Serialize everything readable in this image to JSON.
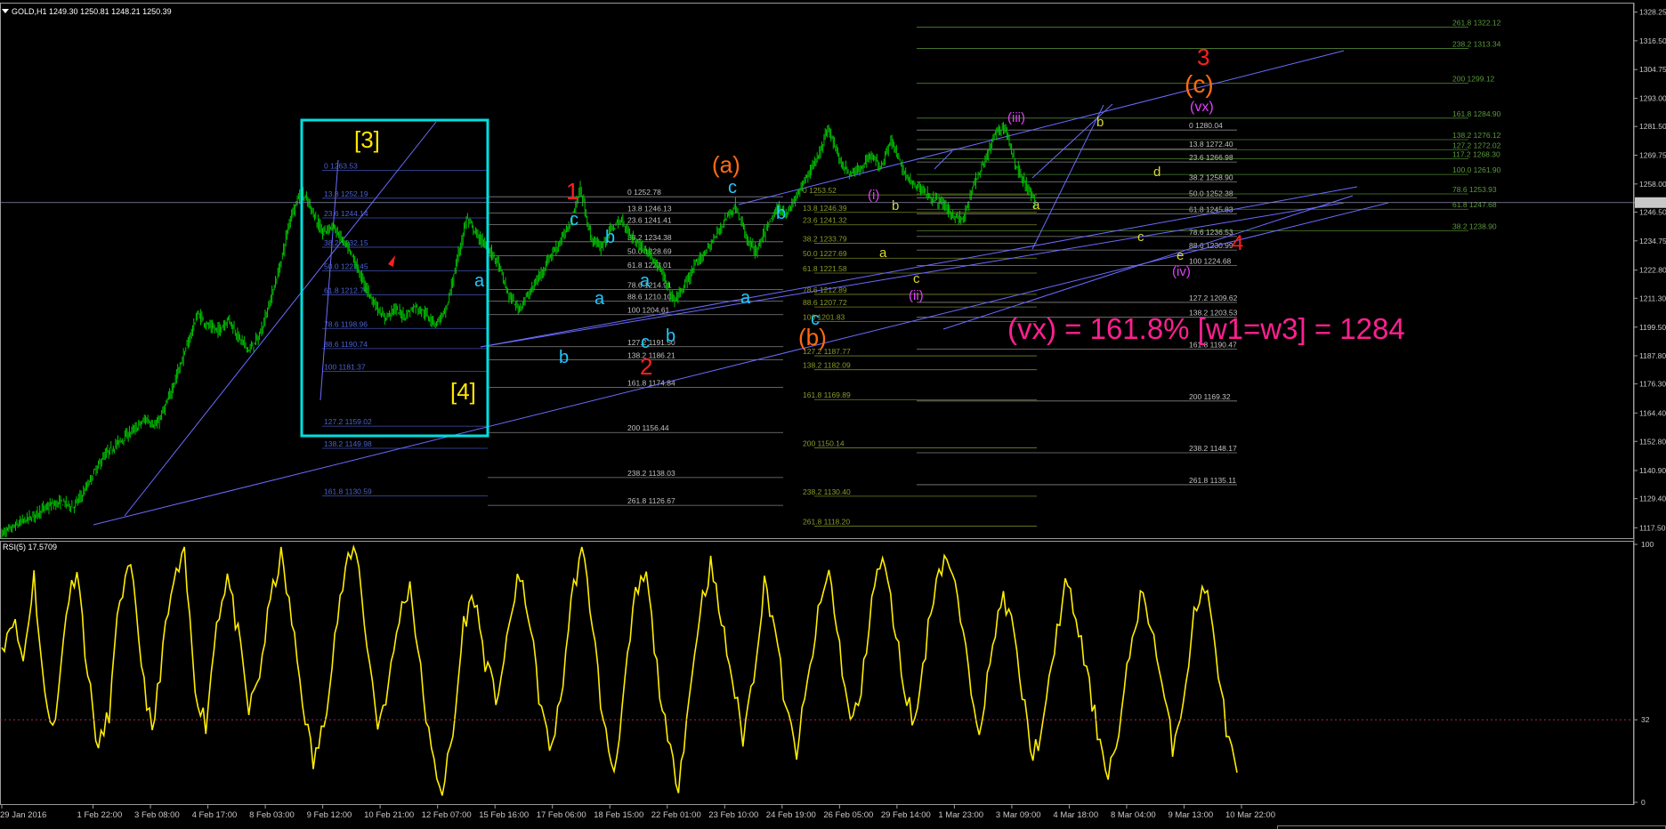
{
  "header": {
    "symbol": "GOLD,H1",
    "ohlc": "1249.30 1250.81 1248.21 1250.39",
    "rsi_label": "RSI(5) 17.5709"
  },
  "annotation_text": "(vx) = 161.8% [w1=w3] = 1284",
  "colors": {
    "background": "#000000",
    "candle": "#00c400",
    "rsi_line": "#ffee00",
    "trend_line": "#6b6bff",
    "box": "#00e0e0",
    "fib_blue": "#4a60d0",
    "fib_olive": "#7a8a1a",
    "fib_green": "#3a8a2a",
    "wave_red": "#ff2020",
    "wave_orange": "#ff6a10",
    "wave_yellow": "#ffe600",
    "wave_cyan": "#22c8ff",
    "wave_magenta": "#e040ff",
    "wave_ylgreen": "#d8d830",
    "vx_pink": "#ff2090"
  },
  "chart_data": [
    {
      "type": "line",
      "title": "GOLD,H1",
      "subtype": "candlestick",
      "y_ticks": [
        "1328.25",
        "1316.50",
        "1304.75",
        "1293.00",
        "1281.50",
        "1269.75",
        "1258.00",
        "1250.39",
        "1246.50",
        "1234.75",
        "1222.80",
        "1211.30",
        "1199.50",
        "1187.80",
        "1176.30",
        "1164.40",
        "1152.80",
        "1140.90",
        "1129.40",
        "1117.50"
      ],
      "ylim": [
        1114,
        1331
      ],
      "x_ticks": [
        "29 Jan 2016",
        "1 Feb 22:00",
        "3 Feb 08:00",
        "4 Feb 17:00",
        "8 Feb 03:00",
        "9 Feb 12:00",
        "10 Feb 21:00",
        "12 Feb 07:00",
        "15 Feb 16:00",
        "17 Feb 06:00",
        "18 Feb 15:00",
        "22 Feb 01:00",
        "23 Feb 10:00",
        "24 Feb 19:00",
        "26 Feb 05:00",
        "29 Feb 14:00",
        "1 Mar 23:00",
        "3 Mar 09:00",
        "4 Mar 18:00",
        "8 Mar 04:00",
        "9 Mar 13:00",
        "10 Mar 22:00"
      ],
      "series": [
        {
          "values": [
            1115,
            1117,
            1120,
            1122,
            1125,
            1127,
            1128,
            1126,
            1132,
            1140,
            1147,
            1151,
            1155,
            1158,
            1162,
            1159,
            1168,
            1180,
            1192,
            1205,
            1200,
            1198,
            1203,
            1195,
            1190,
            1196,
            1210,
            1225,
            1245,
            1255,
            1248,
            1238,
            1241,
            1235,
            1228,
            1218,
            1210,
            1203,
            1207,
            1204,
            1208,
            1205,
            1201,
            1206,
            1225,
            1244,
            1237,
            1232,
            1226,
            1213,
            1207,
            1213,
            1220,
            1228,
            1234,
            1242,
            1256,
            1236,
            1232,
            1240,
            1243,
            1236,
            1232,
            1228,
            1220,
            1210,
            1216,
            1224,
            1230,
            1236,
            1244,
            1249,
            1236,
            1230,
            1240,
            1248,
            1246,
            1254,
            1262,
            1270,
            1281,
            1268,
            1262,
            1264,
            1270,
            1265,
            1276,
            1265,
            1258,
            1256,
            1252,
            1250,
            1245,
            1243,
            1258,
            1266,
            1278,
            1282,
            1266,
            1258,
            1250
          ]
        }
      ],
      "fib_levels": [
        {
          "group": "A",
          "labels": [
            "0 1263.53",
            "13.8 1252.19",
            "23.6 1244.14",
            "38.2 1232.15",
            "50.0 1222.45",
            "61.8 1212.76",
            "78.6 1198.96",
            "88.6 1190.74",
            "100 1181.37",
            "127.2 1159.02",
            "138.2 1149.98",
            "161.8 1130.59"
          ],
          "color": "#4a60d0"
        },
        {
          "group": "B",
          "labels": [
            "0 1252.78",
            "13.8 1246.13",
            "23.6 1241.41",
            "38.2 1234.38",
            "50.0 1228.69",
            "61.8 1223.01",
            "78.6 1214.91",
            "88.6 1210.10",
            "100 1204.61",
            "127.2 1191.50",
            "138.2 1186.21",
            "161.8 1174.84",
            "200 1156.44",
            "238.2 1138.03",
            "261.8 1126.67"
          ],
          "color": "#9a9a9a"
        },
        {
          "group": "C",
          "labels": [
            "0 1253.52",
            "13.8 1246.39",
            "23.6 1241.32",
            "38.2 1233.79",
            "50.0 1227.69",
            "61.8 1221.58",
            "78.6 1212.89",
            "88.6 1207.72",
            "100 1201.83",
            "127.2 1187.77",
            "138.2 1182.09",
            "161.8 1169.89",
            "200 1150.14",
            "238.2 1130.40",
            "261.8 1118.20"
          ],
          "color": "#8a9a2a"
        },
        {
          "group": "D",
          "labels": [
            "0 1280.04",
            "13.8 1272.40",
            "23.6 1266.98",
            "38.2 1258.90",
            "50.0 1252.38",
            "61.8 1245.83",
            "78.6 1236.53",
            "88.6 1230.99",
            "100 1224.68",
            "127.2 1209.62",
            "138.2 1203.53",
            "161.8 1190.47",
            "200 1169.32",
            "238.2 1148.17",
            "261.8 1135.11"
          ],
          "color": "#9a9a9a"
        },
        {
          "group": "E",
          "labels": [
            "261.8 1322.12",
            "238.2 1313.34",
            "200 1299.12",
            "161.8 1284.90",
            "138.2 1276.12",
            "127.2 1272.02",
            "117.2 1268.30",
            "100.0 1261.90",
            "78.6 1253.93",
            "61.8 1247.68",
            "38.2 1238.90"
          ],
          "color": "#5a9a3a"
        }
      ],
      "wave_labels": [
        "[3]",
        "[4]",
        "1",
        "2",
        "3",
        "4",
        "(a)",
        "(b)",
        "(c)",
        "(i)",
        "(ii)",
        "(iii)",
        "(iv)",
        "(vx)",
        "a",
        "b",
        "c",
        "d",
        "e"
      ]
    },
    {
      "type": "line",
      "title": "RSI(5) 17.5709",
      "ylim": [
        0,
        100
      ],
      "y_ticks": [
        "100",
        "32",
        "0"
      ],
      "levels": [
        32
      ],
      "series": [
        {
          "values": [
            60,
            72,
            55,
            88,
            40,
            30,
            75,
            92,
            50,
            20,
            35,
            80,
            90,
            55,
            25,
            60,
            85,
            95,
            45,
            30,
            70,
            88,
            65,
            35,
            50,
            78,
            96,
            70,
            40,
            15,
            30,
            65,
            90,
            99,
            62,
            30,
            45,
            72,
            85,
            50,
            18,
            5,
            25,
            70,
            80,
            55,
            40,
            60,
            88,
            75,
            42,
            20,
            38,
            78,
            99,
            70,
            30,
            12,
            45,
            80,
            88,
            52,
            22,
            8,
            40,
            75,
            92,
            70,
            48,
            25,
            50,
            85,
            68,
            35,
            20,
            45,
            72,
            90,
            60,
            30,
            42,
            80,
            95,
            72,
            45,
            30,
            60,
            88,
            96,
            78,
            50,
            30,
            52,
            80,
            70,
            42,
            18,
            30,
            60,
            85,
            72,
            50,
            28,
            12,
            25,
            58,
            80,
            70,
            45,
            22,
            40,
            72,
            85,
            60,
            28,
            10
          ]
        }
      ]
    }
  ]
}
